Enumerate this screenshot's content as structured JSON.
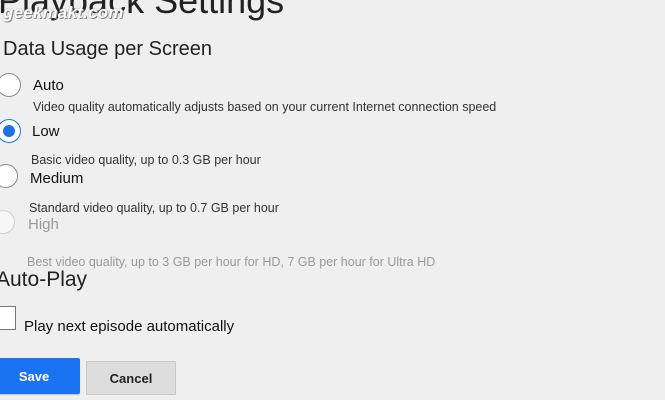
{
  "page": {
    "title": "Playback Settings"
  },
  "watermark": {
    "text": "geekmakt.com"
  },
  "data_usage": {
    "title": "Data Usage per Screen",
    "options": [
      {
        "label": "Auto",
        "description": "Video quality automatically adjusts based on your current Internet connection speed",
        "selected": false,
        "disabled": false
      },
      {
        "label": "Low",
        "description": "Basic video quality, up to 0.3 GB per hour",
        "selected": true,
        "disabled": false
      },
      {
        "label": "Medium",
        "description": "Standard video quality, up to 0.7 GB per hour",
        "selected": false,
        "disabled": false
      },
      {
        "label": "High",
        "description": "Best video quality, up to 3 GB per hour for HD, 7 GB per hour for Ultra HD",
        "selected": false,
        "disabled": true
      }
    ]
  },
  "autoplay": {
    "title": "Auto-Play",
    "checkbox_label": "Play next episode automatically",
    "checked": false
  },
  "buttons": {
    "save": "Save",
    "cancel": "Cancel"
  },
  "colors": {
    "accent": "#1a73e8",
    "background": "#efefef",
    "cancel_bg": "#dddddd"
  }
}
